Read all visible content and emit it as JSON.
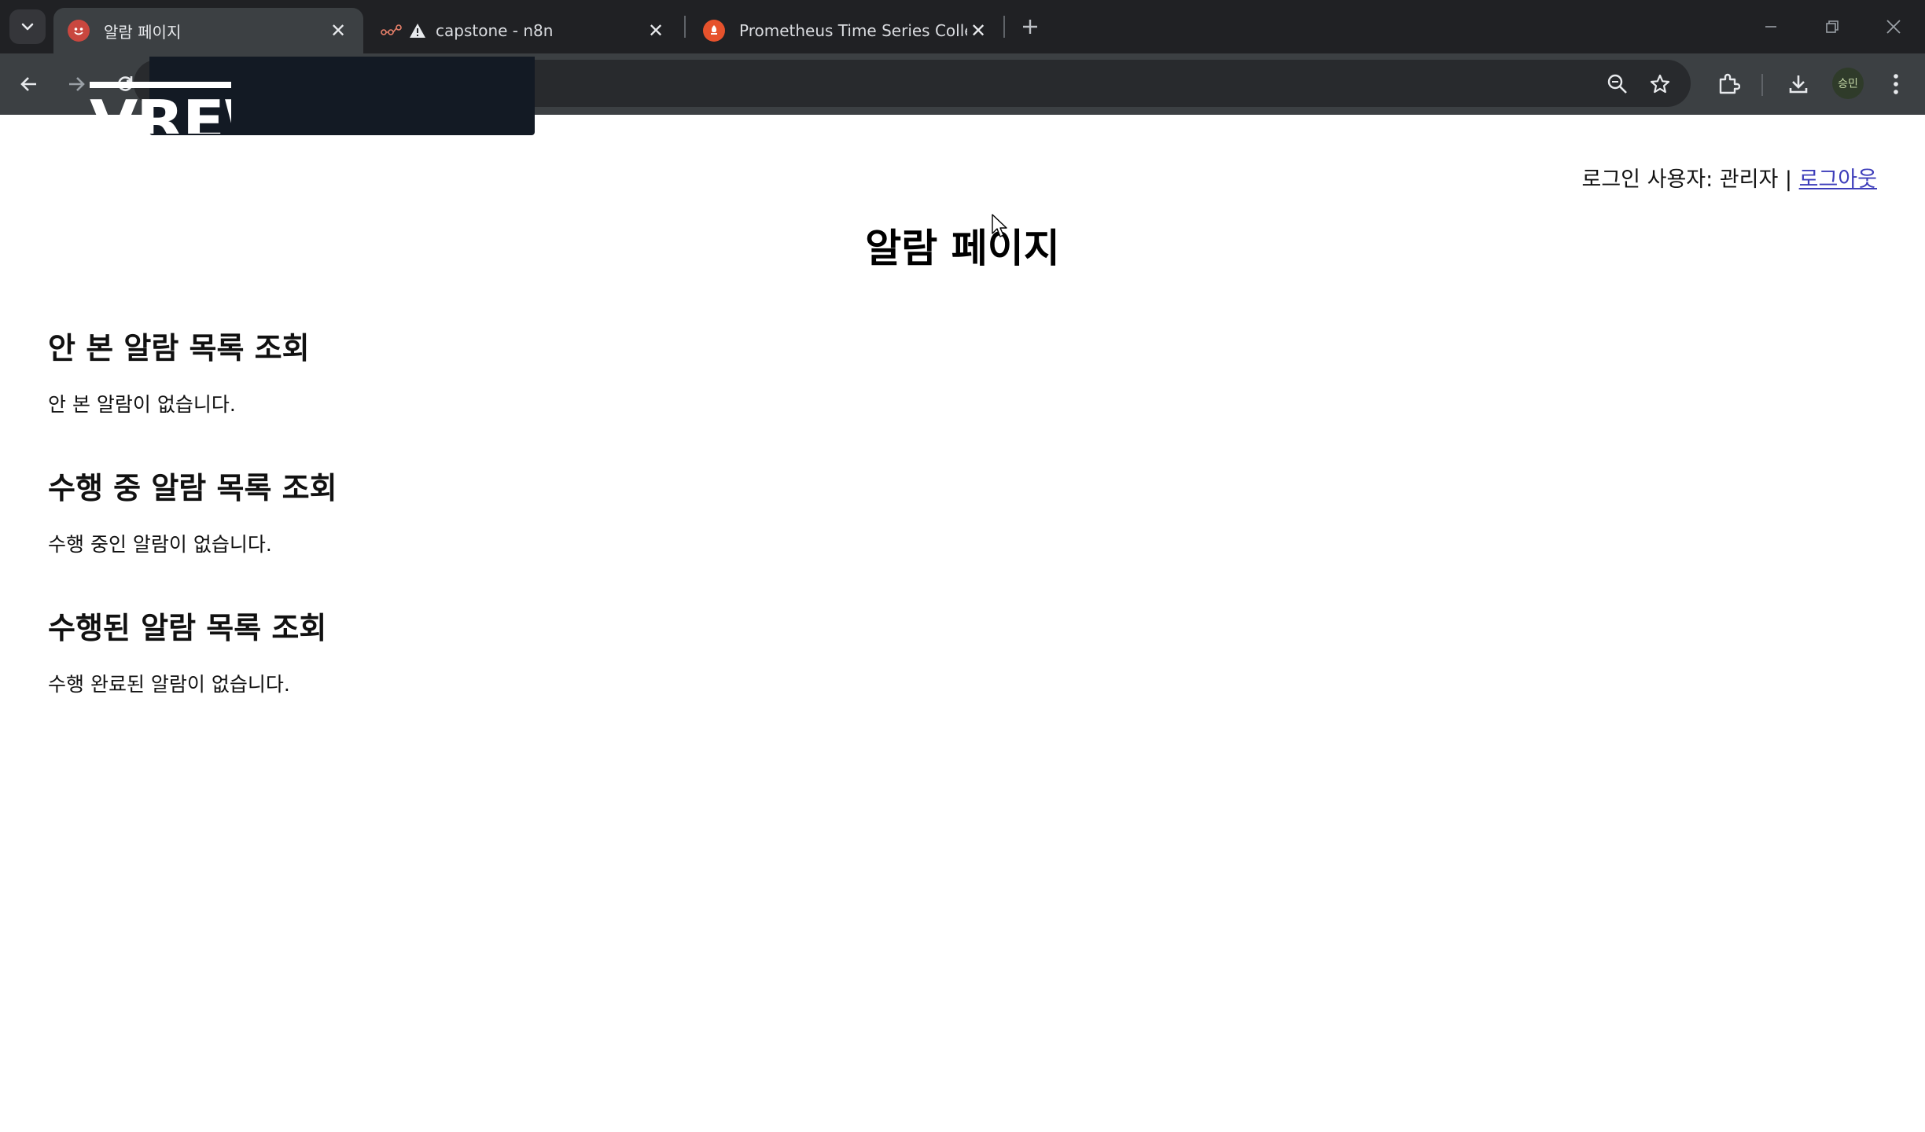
{
  "browser": {
    "tabs": [
      {
        "title": "알람 페이지",
        "active": true,
        "favicon": "red-smiley-icon"
      },
      {
        "title": "capstone - n8n",
        "active": false,
        "favicon": "n8n-icon",
        "warning": true
      },
      {
        "title": "Prometheus Time Series Colle",
        "active": false,
        "favicon": "prometheus-icon"
      }
    ],
    "profile_label": "승민",
    "overlay_logo_text": "VREW"
  },
  "page": {
    "user_label": "로그인 사용자: 관리자",
    "separator": "|",
    "logout_label": "로그아웃",
    "title": "알람 페이지",
    "sections": [
      {
        "heading": "안 본 알람 목록 조회",
        "empty_text": "안 본 알람이 없습니다."
      },
      {
        "heading": "수행 중 알람 목록 조회",
        "empty_text": "수행 중인 알람이 없습니다."
      },
      {
        "heading": "수행된 알람 목록 조회",
        "empty_text": "수행 완료된 알람이 없습니다."
      }
    ]
  },
  "colors": {
    "chrome_dark": "#202124",
    "toolbar": "#3c4043",
    "link": "#3d3dba"
  }
}
